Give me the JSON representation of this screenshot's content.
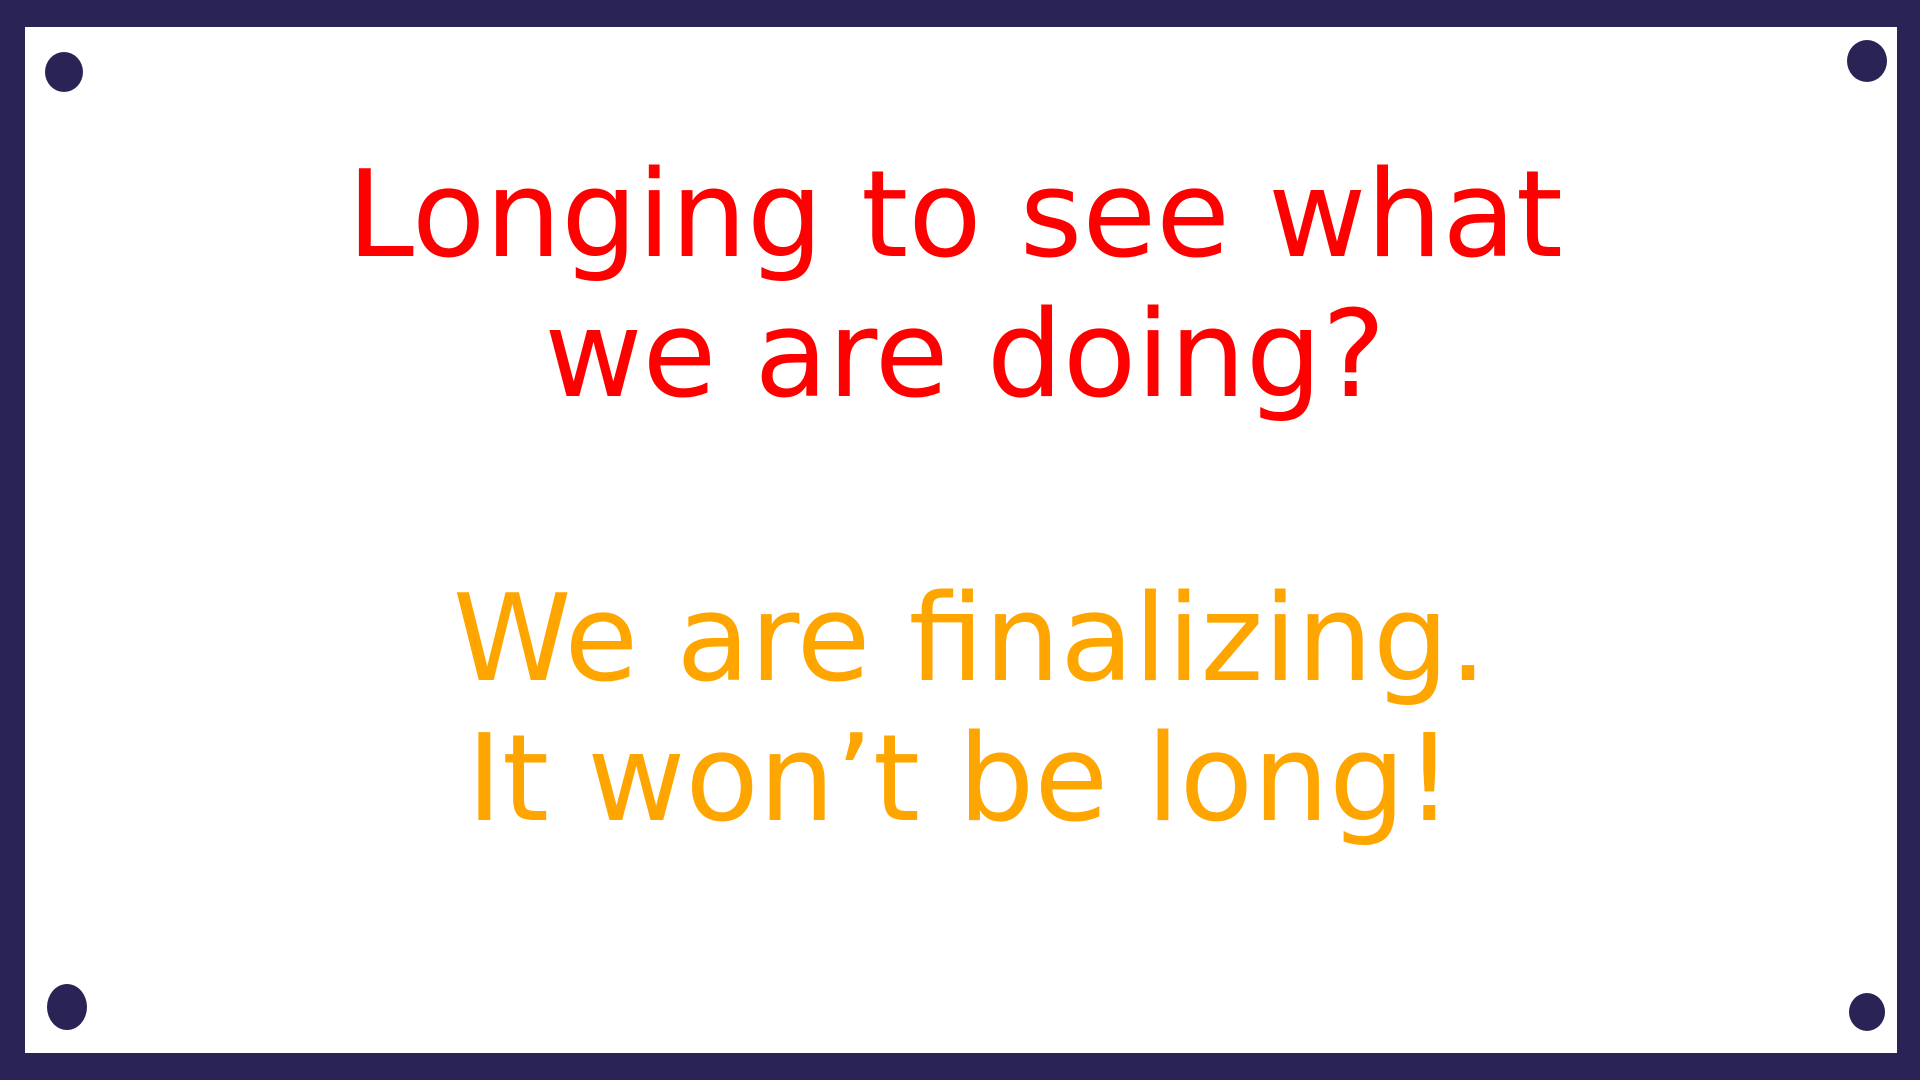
{
  "heading": {
    "line1": "Longing to see what",
    "line2": "we are doing?"
  },
  "message": {
    "line1": "We are finalizing.",
    "line2": "It won’t be long!"
  },
  "colors": {
    "frame": "#292455",
    "panel": "#ffffff",
    "heading": "#ff0000",
    "message": "#ffa500"
  }
}
